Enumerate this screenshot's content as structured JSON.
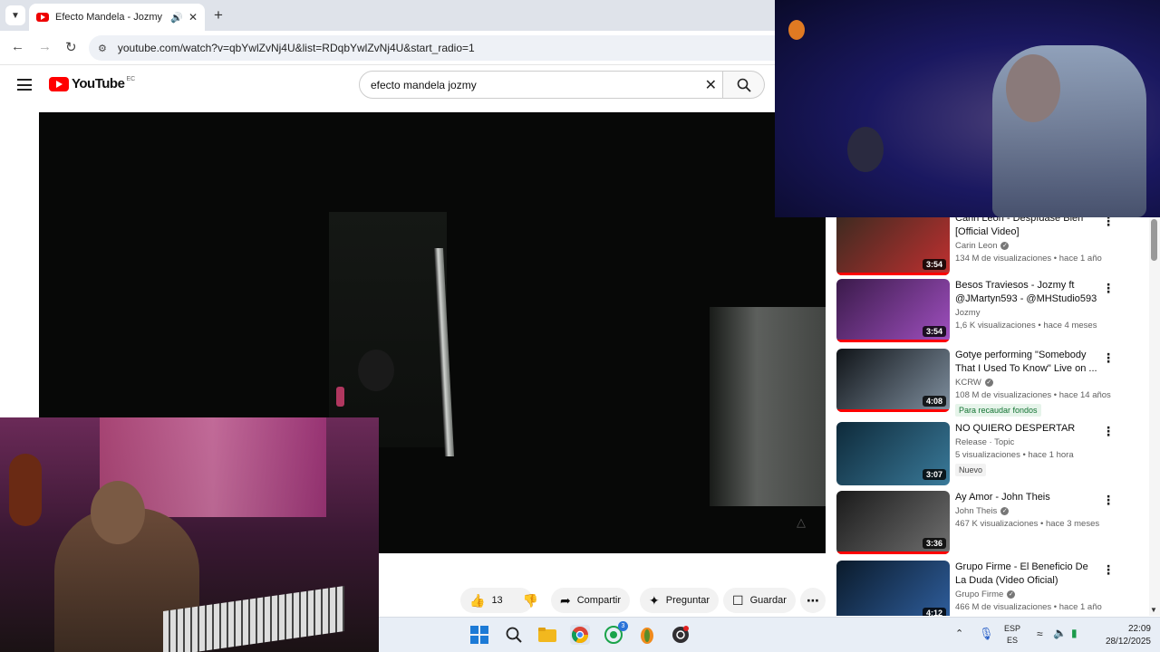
{
  "browser": {
    "tab_title": "Efecto Mandela - Jozmy - Yo",
    "url": "youtube.com/watch?v=qbYwlZvNj4U&list=RDqbYwlZvNj4U&start_radio=1"
  },
  "youtube": {
    "logo_text": "YouTube",
    "region": "EC",
    "search_query": "efecto mandela jozmy"
  },
  "actions": {
    "like_count": "13",
    "share_label": "Compartir",
    "ask_label": "Preguntar",
    "save_label": "Guardar"
  },
  "recommendations": [
    {
      "title": "Carin Leon - Despídase Bien [Official Video]",
      "channel": "Carin Leon",
      "verified": true,
      "meta": "134 M de visualizaciones • hace 1 año",
      "duration": "3:54",
      "badge": "",
      "thumb_colors": [
        "#3a2a20",
        "#c03030"
      ]
    },
    {
      "title": "Besos Traviesos - Jozmy ft @JMartyn593 - @MHStudio593",
      "channel": "Jozmy",
      "verified": false,
      "meta": "1,6 K visualizaciones • hace 4 meses",
      "duration": "3:54",
      "badge": "",
      "thumb_colors": [
        "#3a1a4a",
        "#a050c0"
      ]
    },
    {
      "title": "Gotye performing \"Somebody That I Used To Know\" Live on ...",
      "channel": "KCRW",
      "verified": true,
      "meta": "108 M de visualizaciones • hace 14 años",
      "duration": "4:08",
      "badge": "Para recaudar fondos",
      "thumb_colors": [
        "#101418",
        "#8090a0"
      ]
    },
    {
      "title": "NO QUIERO DESPERTAR",
      "channel": "Release · Topic",
      "verified": false,
      "meta": "5 visualizaciones • hace 1 hora",
      "duration": "3:07",
      "badge": "Nuevo",
      "thumb_colors": [
        "#0e2a3a",
        "#3a7a9a"
      ]
    },
    {
      "title": "Ay Amor - John Theis",
      "channel": "John Theis",
      "verified": true,
      "meta": "467 K visualizaciones • hace 3 meses",
      "duration": "3:36",
      "badge": "",
      "thumb_colors": [
        "#1a1a1a",
        "#707070"
      ]
    },
    {
      "title": "Grupo Firme - El Beneficio De La Duda (Video Oficial)",
      "channel": "Grupo Firme",
      "verified": true,
      "meta": "466 M de visualizaciones • hace 1 año",
      "duration": "4:12",
      "badge": "",
      "thumb_colors": [
        "#0a1a2a",
        "#3060a0"
      ]
    }
  ],
  "taskbar": {
    "whatsapp_badge": "3",
    "lang_top": "ESP",
    "lang_bottom": "ES",
    "time": "22:09",
    "date": "28/12/2025"
  }
}
